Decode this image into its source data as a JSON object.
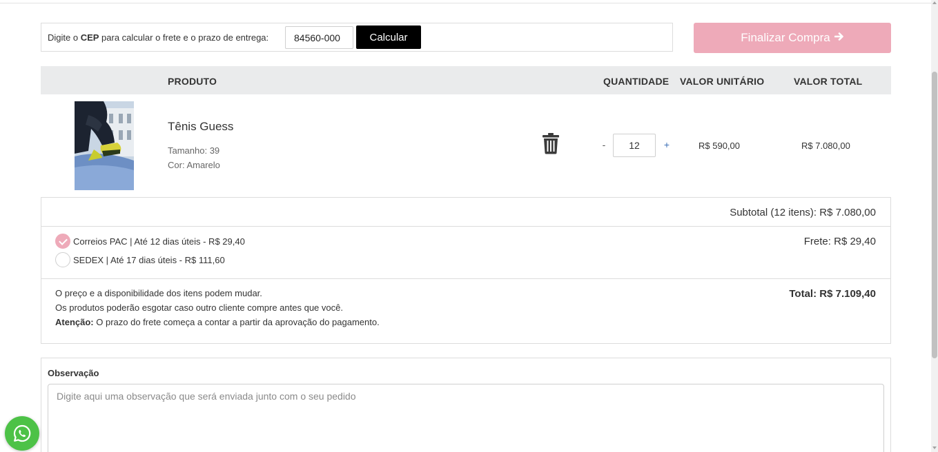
{
  "cep": {
    "label_prefix": "Digite o ",
    "label_bold": "CEP",
    "label_suffix": " para calcular o frete e o prazo de entrega:",
    "value": "84560-000",
    "button_label": "Calcular"
  },
  "checkout": {
    "finalize_label": "Finalizar Compra",
    "finalize_icon": "arrow-right-icon",
    "accent_color": "#eeaab9"
  },
  "table": {
    "headers": {
      "product": "PRODUTO",
      "quantity": "QUANTIDADE",
      "unit_price": "VALOR UNITÁRIO",
      "total": "VALOR TOTAL"
    },
    "items": [
      {
        "name": "Tênis Guess",
        "size": "Tamanho: 39",
        "color": "Cor: Amarelo",
        "quantity": "12",
        "unit_price": "R$ 590,00",
        "total": "R$ 7.080,00"
      }
    ]
  },
  "summary": {
    "subtotal": "Subtotal (12 itens): R$ 7.080,00",
    "shipping_options": [
      {
        "label": "Correios PAC | Até 12 dias úteis - R$ 29,40",
        "selected": true
      },
      {
        "label": "SEDEX | Até 17 dias úteis - R$ 111,60",
        "selected": false
      }
    ],
    "freight": "Frete: R$ 29,40",
    "notice_line1": "O preço e a disponibilidade dos itens podem mudar.",
    "notice_line2": "Os produtos poderão esgotar caso outro cliente compre antes que você.",
    "notice_attention_label": "Atenção:",
    "notice_attention_text": " O prazo do frete começa a contar a partir da aprovação do pagamento.",
    "total": "Total: R$ 7.109,40"
  },
  "observation": {
    "title": "Observação",
    "placeholder": "Digite aqui uma observação que será enviada junto com o seu pedido"
  },
  "whatsapp": {
    "icon": "whatsapp-icon",
    "color": "#4dc247"
  }
}
